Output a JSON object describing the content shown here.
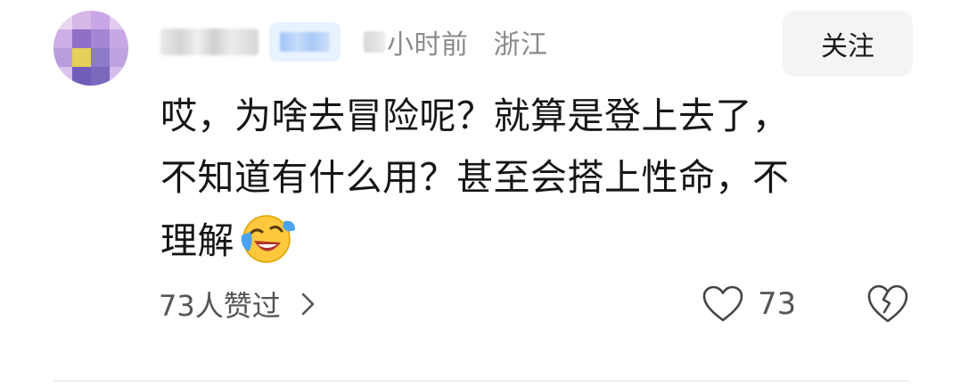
{
  "comment": {
    "time_text": "小时前",
    "location": "浙江",
    "follow_label": "关注",
    "body_lines": [
      "哎，为啥去冒险呢？就算是登上去了，",
      "不知道有什么用？甚至会搭上性命，不",
      "理解"
    ],
    "emoji": "laughing-crying-emoji",
    "likes_summary": "73人赞过",
    "like_count": "73",
    "icons": {
      "chevron": "chevron-right-icon",
      "like": "heart-icon",
      "dislike": "broken-heart-icon"
    },
    "colors": {
      "badge_bg": "#e9f2ff",
      "meta_text": "#8a8a8a",
      "body_text": "#161616",
      "button_bg": "#f4f4f4"
    }
  }
}
